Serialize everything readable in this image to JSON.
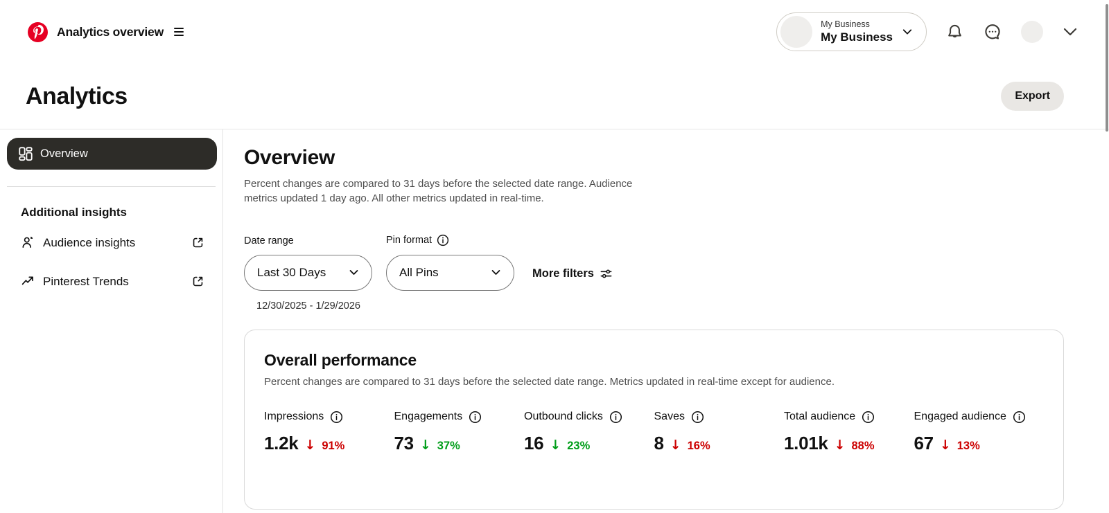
{
  "topbar": {
    "app_title": "Analytics overview",
    "account": {
      "eyebrow": "My Business",
      "name": "My Business"
    }
  },
  "page": {
    "title": "Analytics",
    "export_label": "Export"
  },
  "sidebar": {
    "overview_label": "Overview",
    "section_heading": "Additional insights",
    "links": [
      {
        "label": "Audience insights"
      },
      {
        "label": "Pinterest Trends"
      }
    ]
  },
  "main": {
    "heading": "Overview",
    "description": "Percent changes are compared to 31 days before the selected date range. Audience metrics updated 1 day ago. All other metrics updated in real-time.",
    "filters": {
      "date_range_label": "Date range",
      "date_range_value": "Last 30 Days",
      "pin_format_label": "Pin format",
      "pin_format_value": "All Pins",
      "more_filters_label": "More filters",
      "date_range_caption": "12/30/2025 - 1/29/2026"
    },
    "card": {
      "title": "Overall performance",
      "subtitle": "Percent changes are compared to 31 days before the selected date range. Metrics updated in real-time except for audience.",
      "metrics": [
        {
          "label": "Impressions",
          "value": "1.2k",
          "direction": "down",
          "change": "91%",
          "trend_color": "negative"
        },
        {
          "label": "Engagements",
          "value": "73",
          "direction": "down",
          "change": "37%",
          "trend_color": "positive"
        },
        {
          "label": "Outbound clicks",
          "value": "16",
          "direction": "down",
          "change": "23%",
          "trend_color": "positive"
        },
        {
          "label": "Saves",
          "value": "8",
          "direction": "down",
          "change": "16%",
          "trend_color": "negative"
        },
        {
          "label": "Total audience",
          "value": "1.01k",
          "direction": "down",
          "change": "88%",
          "trend_color": "negative"
        },
        {
          "label": "Engaged audience",
          "value": "67",
          "direction": "down",
          "change": "13%",
          "trend_color": "negative"
        }
      ]
    }
  },
  "colors": {
    "brand_red": "#e60023",
    "negative": "#cc0000",
    "positive": "#009e19",
    "selected_nav_bg": "#2d2c28"
  }
}
